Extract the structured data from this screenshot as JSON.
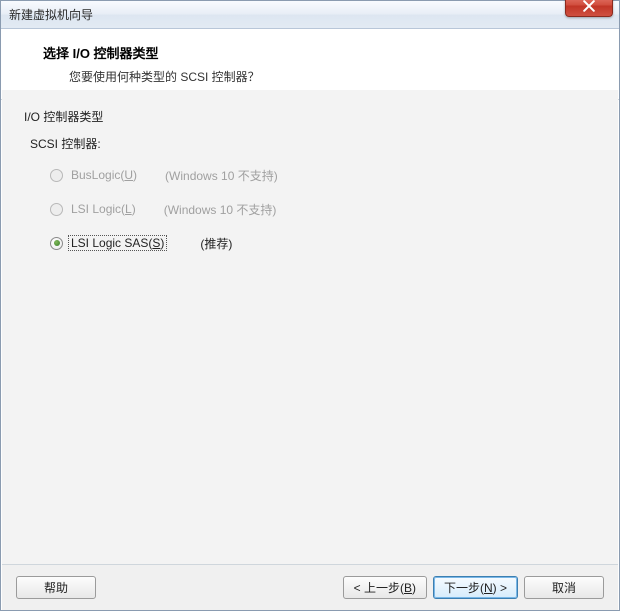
{
  "window": {
    "title": "新建虚拟机向导"
  },
  "header": {
    "title": "选择 I/O 控制器类型",
    "subtitle": "您要使用何种类型的 SCSI 控制器？"
  },
  "body": {
    "section_label": "I/O 控制器类型",
    "scsi_label": "SCSI 控制器:",
    "options": [
      {
        "label_pre": "BusLogic(",
        "accel": "U",
        "label_post": ")",
        "note": "(Windows 10 不支持)",
        "enabled": false,
        "checked": false
      },
      {
        "label_pre": "LSI Logic(",
        "accel": "L",
        "label_post": ")",
        "note": "(Windows 10 不支持)",
        "enabled": false,
        "checked": false
      },
      {
        "label_pre": "LSI Logic SAS(",
        "accel": "S",
        "label_post": ")",
        "note": "(推荐)",
        "enabled": true,
        "checked": true
      }
    ]
  },
  "footer": {
    "help": "帮助",
    "back_pre": "< 上一步(",
    "back_accel": "B",
    "back_post": ")",
    "next_pre": "下一步(",
    "next_accel": "N",
    "next_post": ") >",
    "cancel": "取消"
  }
}
